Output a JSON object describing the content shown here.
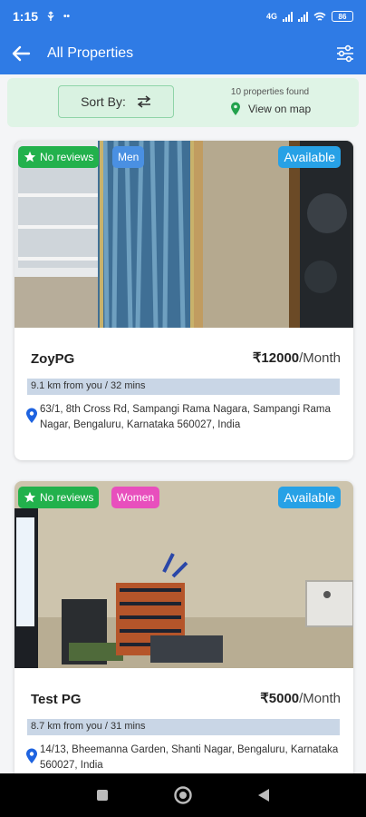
{
  "status": {
    "time": "1:15",
    "network_label": "4G",
    "battery": "86"
  },
  "app_bar": {
    "title": "All Properties"
  },
  "toolbar": {
    "sort_label": "Sort By:",
    "found_text": "10 properties found",
    "view_map": "View on map"
  },
  "cards": [
    {
      "reviews": "No reviews",
      "gender": "Men",
      "availability": "Available",
      "name": "ZoyPG",
      "price": "₹12000",
      "per": "/Month",
      "distance": "9.1 km from you / 32 mins",
      "address": "63/1, 8th Cross Rd, Sampangi Rama Nagara, Sampangi Rama Nagar, Bengaluru, Karnataka 560027, India"
    },
    {
      "reviews": "No reviews",
      "gender": "Women",
      "availability": "Available",
      "name": "Test PG",
      "price": "₹5000",
      "per": "/Month",
      "distance": "8.7 km from you / 31 mins",
      "address": "14/13, Bheemanna Garden, Shanti Nagar, Bengaluru, Karnataka 560027, India"
    }
  ],
  "colors": {
    "primary": "#2f7be5",
    "reviews_badge": "#22b14c",
    "men_badge": "#4a90e2",
    "women_badge": "#e84fbd",
    "available_badge": "#27a1e6"
  }
}
